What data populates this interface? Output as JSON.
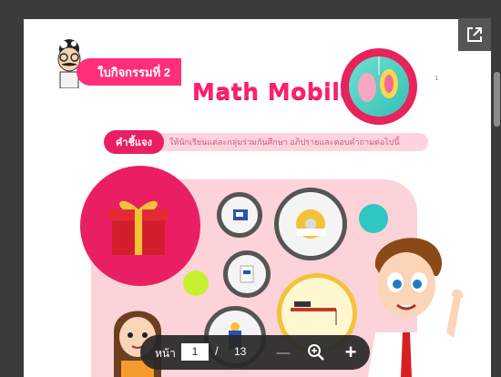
{
  "document": {
    "activity_label": "ใบกิจกรรมที่ 2",
    "title": "Math Mobile",
    "small_page_number": "1",
    "instruction_badge": "คำชี้แจง",
    "instruction_text": "ให้นักเรียนแต่ละกลุ่มร่วมกันศึกษา อภิปรายและตอบคำถามต่อไปนี้"
  },
  "toolbar": {
    "page_label": "หน้า",
    "current_page": "1",
    "separator": "/",
    "total_pages": "13",
    "zoom_out_glyph": "—",
    "zoom_in_glyph": "+"
  },
  "icons": {
    "popout": "external-link-icon",
    "zoom_out": "minus-icon",
    "zoom_fit": "magnifier-plus-icon",
    "zoom_in": "plus-icon"
  },
  "colors": {
    "accent_pink": "#e91e63",
    "board_pink": "#fcd3d9",
    "toolbar_bg": "#282828",
    "viewer_bg": "#3b3b3b"
  }
}
